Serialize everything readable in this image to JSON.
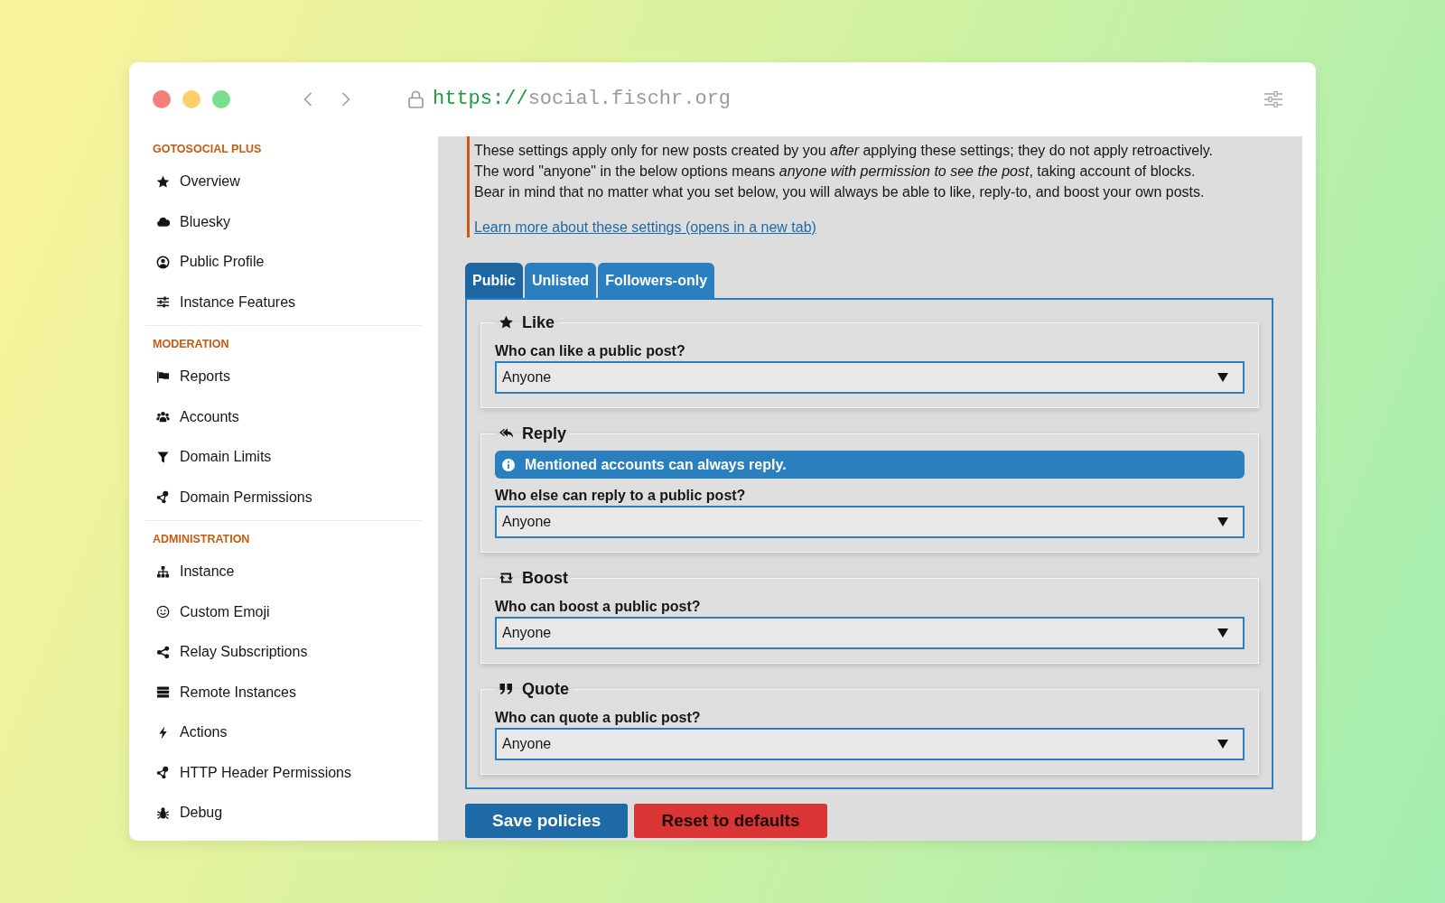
{
  "browser": {
    "url": {
      "scheme": "https://",
      "host": "social.fischr.org"
    }
  },
  "sidebar": {
    "sections": [
      {
        "heading": "GOTOSOCIAL PLUS",
        "items": [
          {
            "label": "Overview",
            "selected": false
          },
          {
            "label": "Bluesky",
            "selected": false
          },
          {
            "label": "Public Profile",
            "selected": false
          },
          {
            "label": "Instance Features",
            "selected": false
          }
        ]
      },
      {
        "heading": "MODERATION",
        "items": [
          {
            "label": "Reports",
            "selected": false
          },
          {
            "label": "Accounts",
            "selected": false
          },
          {
            "label": "Domain Limits",
            "selected": false
          },
          {
            "label": "Domain Permissions",
            "selected": false
          }
        ]
      },
      {
        "heading": "ADMINISTRATION",
        "items": [
          {
            "label": "Instance",
            "selected": false
          },
          {
            "label": "Custom Emoji",
            "selected": false
          },
          {
            "label": "Relay Subscriptions",
            "selected": false
          },
          {
            "label": "Remote Instances",
            "selected": false
          },
          {
            "label": "Actions",
            "selected": false
          },
          {
            "label": "HTTP Header Permissions",
            "selected": false
          },
          {
            "label": "Debug",
            "selected": false
          }
        ]
      }
    ]
  },
  "main": {
    "intro": {
      "lines": [
        "These settings apply only for new posts created by you *after* applying these settings; they do not apply retroactively.",
        "The word \"anyone\" in the below options means *anyone with permission to see the post*, taking account of blocks.",
        "Bear in mind that no matter what you set below, you will always be able to like, reply-to, and boost your own posts."
      ],
      "link": "Learn more about these settings (opens in a new tab)"
    },
    "tabs": [
      {
        "label": "Public",
        "selected": true
      },
      {
        "label": "Unlisted",
        "selected": false
      },
      {
        "label": "Followers-only",
        "selected": false
      }
    ],
    "policies": [
      {
        "title": "Like",
        "question": "Who can like a public post?",
        "value": "Anyone"
      },
      {
        "title": "Reply",
        "notice": "Mentioned accounts can always reply.",
        "question": "Who else can reply to a public post?",
        "value": "Anyone"
      },
      {
        "title": "Boost",
        "question": "Who can boost a public post?",
        "value": "Anyone"
      },
      {
        "title": "Quote",
        "question": "Who can quote a public post?",
        "value": "Anyone"
      }
    ],
    "buttons": [
      {
        "label": "Save policies",
        "kind": "primary"
      },
      {
        "label": "Reset to defaults",
        "kind": "danger"
      }
    ]
  }
}
